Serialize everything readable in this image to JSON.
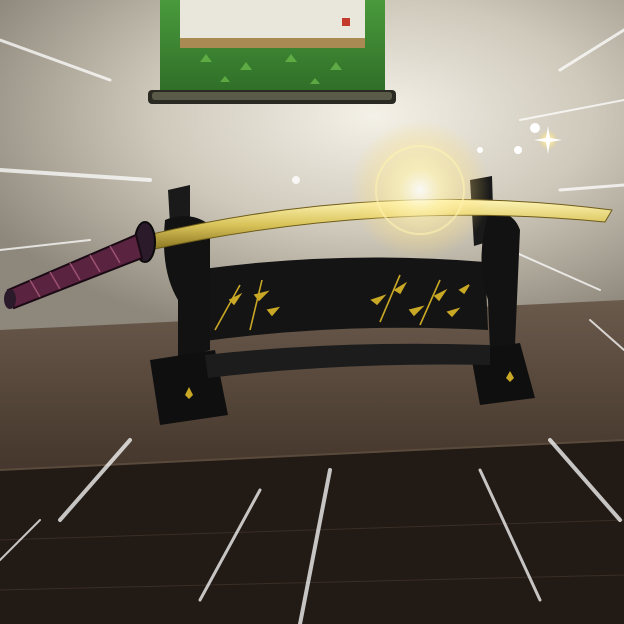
{
  "scene": {
    "description_name": "golden-katana-on-lacquered-stand",
    "colors": {
      "wall": "#d8d2c4",
      "floor": "#3a2c22",
      "scroll_green": "#3f8a34",
      "blade_gold": "#d9c45a",
      "hilt_purple": "#5a2340",
      "stand_black": "#151515",
      "bamboo_gold": "#c9a825",
      "glow": "#fff3b0"
    }
  }
}
